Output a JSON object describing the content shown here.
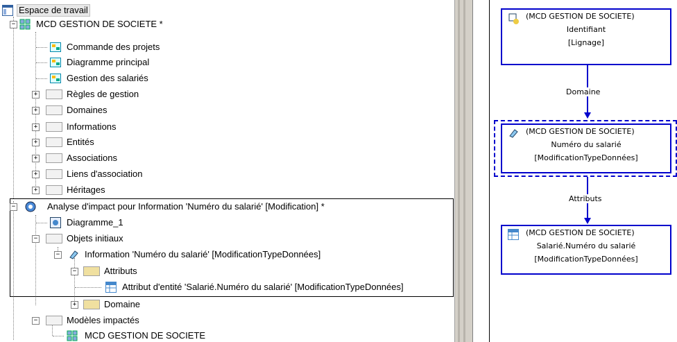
{
  "tree": {
    "workspace": "Espace de travail",
    "model": "MCD GESTION DE SOCIETE *",
    "diagrams": [
      "Commande des projets",
      "Diagramme principal",
      "Gestion des salariés"
    ],
    "folders": [
      "Règles de gestion",
      "Domaines",
      "Informations",
      "Entités",
      "Associations",
      "Liens d'association",
      "Héritages"
    ],
    "impact": "Analyse d'impact pour Information 'Numéro du salarié' [Modification] *",
    "diagram1": "Diagramme_1",
    "initial": "Objets initiaux",
    "info": "Information 'Numéro du salarié' [ModificationTypeDonnées]",
    "attributs": "Attributs",
    "attr_item": "Attribut d'entité 'Salarié.Numéro du salarié' [ModificationTypeDonnées]",
    "domaine": "Domaine",
    "impacted": "Modèles impactés",
    "impacted_model": "MCD GESTION DE SOCIETE"
  },
  "diagram": {
    "node1": {
      "title": "(MCD GESTION DE SOCIETE)",
      "line2": "Identifiant",
      "line3": "[Lignage]"
    },
    "link1": "Domaine",
    "node2": {
      "title": "(MCD GESTION DE SOCIETE)",
      "line2": "Numéro du salarié",
      "line3": "[ModificationTypeDonnées]"
    },
    "link2": "Attributs",
    "node3": {
      "title": "(MCD GESTION DE SOCIETE)",
      "line2": "Salarié.Numéro du salarié",
      "line3": "[ModificationTypeDonnées]"
    }
  }
}
